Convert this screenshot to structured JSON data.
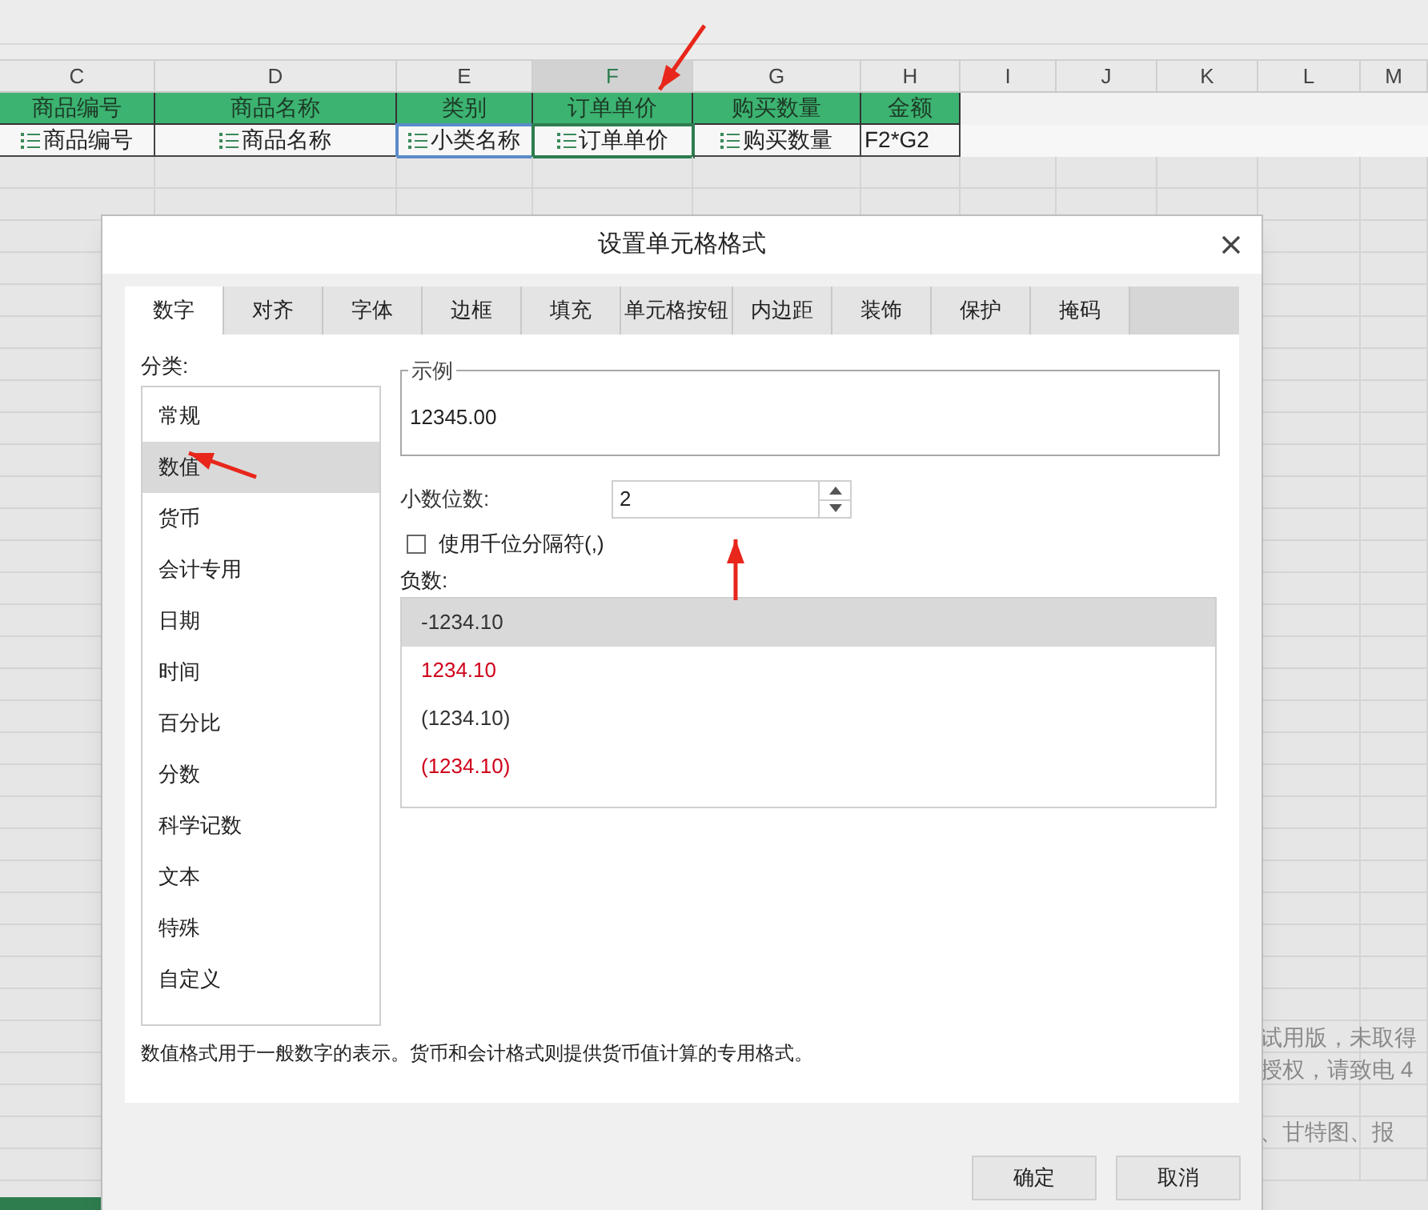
{
  "sheet": {
    "column_headers": [
      {
        "label": "C",
        "selected": false
      },
      {
        "label": "D",
        "selected": false
      },
      {
        "label": "E",
        "selected": false
      },
      {
        "label": "F",
        "selected": true
      },
      {
        "label": "G",
        "selected": false
      },
      {
        "label": "H",
        "selected": false
      },
      {
        "label": "I",
        "selected": false
      },
      {
        "label": "J",
        "selected": false
      },
      {
        "label": "K",
        "selected": false
      },
      {
        "label": "L",
        "selected": false
      },
      {
        "label": "M",
        "selected": false
      }
    ],
    "header_row": [
      "商品编号",
      "商品名称",
      "类别",
      "订单单价",
      "购买数量",
      "金额"
    ],
    "data_row": [
      {
        "text": "商品编号",
        "kind": "field"
      },
      {
        "text": "商品名称",
        "kind": "field"
      },
      {
        "text": "小类名称",
        "kind": "field"
      },
      {
        "text": "订单单价",
        "kind": "field"
      },
      {
        "text": "购买数量",
        "kind": "field"
      },
      {
        "text": "F2*G2",
        "kind": "formula"
      }
    ],
    "trial_notice": [
      "试用版，未取得",
      "授权，请致电 4",
      "、甘特图、报"
    ]
  },
  "dialog": {
    "title": "设置单元格格式",
    "tabs": [
      {
        "label": "数字",
        "selected": true
      },
      {
        "label": "对齐",
        "selected": false
      },
      {
        "label": "字体",
        "selected": false
      },
      {
        "label": "边框",
        "selected": false
      },
      {
        "label": "填充",
        "selected": false
      },
      {
        "label": "单元格按钮",
        "selected": false
      },
      {
        "label": "内边距",
        "selected": false
      },
      {
        "label": "装饰",
        "selected": false
      },
      {
        "label": "保护",
        "selected": false
      },
      {
        "label": "掩码",
        "selected": false
      }
    ],
    "category_label": "分类:",
    "categories": [
      {
        "label": "常规",
        "selected": false
      },
      {
        "label": "数值",
        "selected": true
      },
      {
        "label": "货币",
        "selected": false
      },
      {
        "label": "会计专用",
        "selected": false
      },
      {
        "label": "日期",
        "selected": false
      },
      {
        "label": "时间",
        "selected": false
      },
      {
        "label": "百分比",
        "selected": false
      },
      {
        "label": "分数",
        "selected": false
      },
      {
        "label": "科学记数",
        "selected": false
      },
      {
        "label": "文本",
        "selected": false
      },
      {
        "label": "特殊",
        "selected": false
      },
      {
        "label": "自定义",
        "selected": false
      }
    ],
    "sample": {
      "legend": "示例",
      "value": "12345.00"
    },
    "decimal": {
      "label": "小数位数:",
      "value": "2"
    },
    "thousands": {
      "label": "使用千位分隔符(,)",
      "checked": false
    },
    "negative": {
      "label": "负数:",
      "options": [
        {
          "text": "-1234.10",
          "selected": true,
          "color": "#333333"
        },
        {
          "text": "1234.10",
          "selected": false,
          "color": "#d0021b"
        },
        {
          "text": "(1234.10)",
          "selected": false,
          "color": "#333333"
        },
        {
          "text": "(1234.10)",
          "selected": false,
          "color": "#d0021b"
        }
      ]
    },
    "description": "数值格式用于一般数字的表示。货币和会计格式则提供货币值计算的专用格式。",
    "buttons": [
      "确定",
      "取消"
    ]
  }
}
